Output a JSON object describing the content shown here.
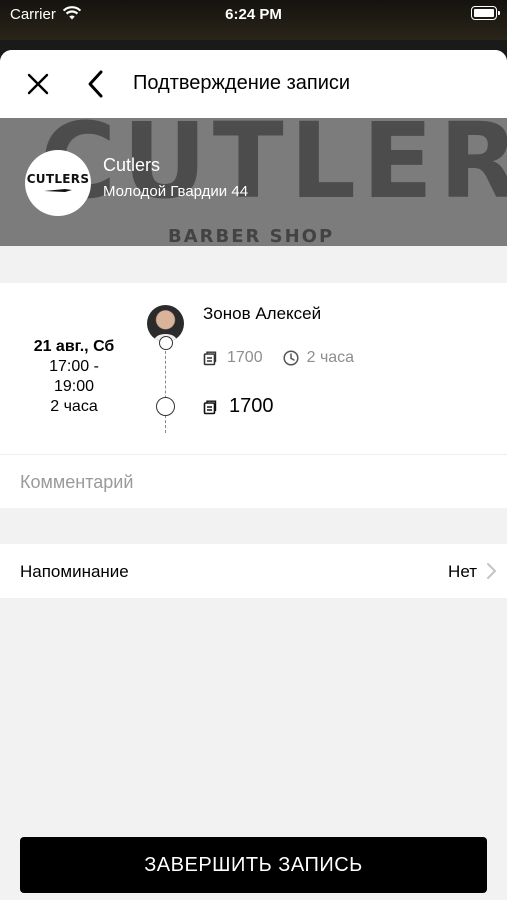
{
  "status_bar": {
    "carrier": "Carrier",
    "time": "6:24 PM"
  },
  "nav": {
    "title": "Подтверждение записи",
    "close_icon": "close-icon",
    "back_icon": "chevron-left-icon"
  },
  "shop": {
    "banner_text": "CUTLERS",
    "banner_subtext": "BARBER SHOP",
    "logo": {
      "main": "CUTLERS"
    },
    "name": "Cutlers",
    "address": "Молодой Гвардии 44"
  },
  "booking": {
    "date": "21 авг., Сб",
    "time_from": "17:00 -",
    "time_to": "19:00",
    "duration": "2 часа",
    "master": "Зонов Алексей",
    "service_price": "1700",
    "service_duration": "2 часа",
    "total": "1700"
  },
  "comment": {
    "placeholder": "Комментарий"
  },
  "reminder": {
    "label": "Напоминание",
    "value": "Нет"
  },
  "finish_button": {
    "label": "ЗАВЕРШИТЬ ЗАПИСЬ"
  },
  "colors": {
    "sheet_bg": "#f2f2f2",
    "button_bg": "#000000",
    "muted_text": "#8e8e8e"
  }
}
